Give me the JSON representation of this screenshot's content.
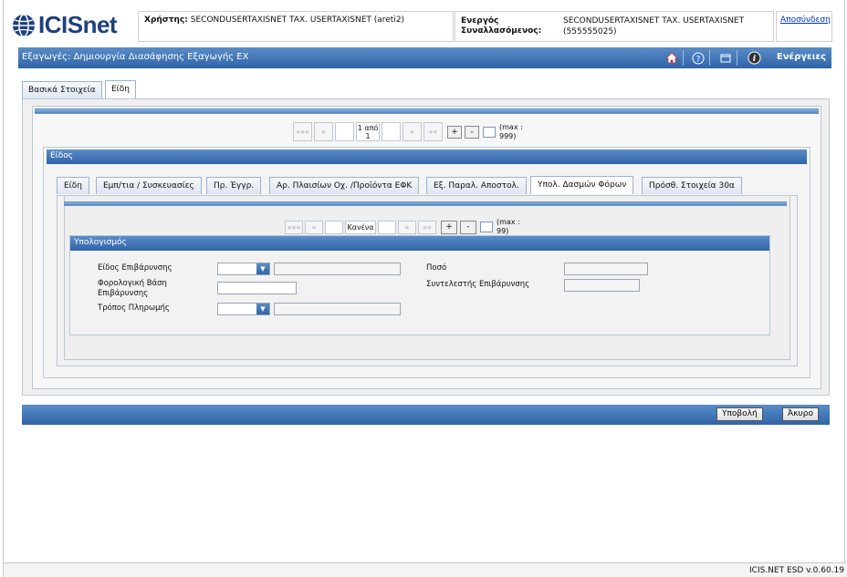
{
  "header": {
    "logo_text": "ICISnet",
    "user_label": "Χρήστης:",
    "user_value": "SECONDUSERTAXISNET TAX. USERTAXISNET (areti2)",
    "active_label": "Ενεργός Συναλλασόμενος:",
    "active_value": "SECONDUSERTAXISNET TAX. USERTAXISNET (555555025)",
    "logout": "Αποσύνδεση"
  },
  "titlebar": {
    "title": "Εξαγωγές: Δημιουργία Διασάφησης Εξαγωγής ΕΧ",
    "actions": "Ενέργειες"
  },
  "main_tabs": [
    "Βασικά Στοιχεία",
    "Είδη"
  ],
  "outer_pager": {
    "first": "«««",
    "prev": "«",
    "page_text": "1 από 1",
    "next": "»",
    "last": "»»",
    "plus": "+",
    "minus": "-",
    "max": "(max : 999)"
  },
  "eidos_section": {
    "title": "Είδος"
  },
  "sub_tabs": [
    "Είδη",
    "Εμπ/τια / Συσκευασίες",
    "Πρ. Έγγρ.",
    "Αρ. Πλαισίων Οχ. /Προϊόντα ΕΦΚ",
    "Εξ. Παραλ. Αποστολ.",
    "Υπολ. Δασμών Φόρων",
    "Πρόσθ. Στοιχεία 30α"
  ],
  "inner_pager": {
    "first": "«««",
    "prev": "«",
    "page_text": "Κανένα",
    "next": "»",
    "last": "»»",
    "plus": "+",
    "minus": "-",
    "max": "(max : 99)"
  },
  "calc_section": {
    "title": "Υπολογισμός",
    "labels": {
      "charge_type": "Είδος Επιβάρυνσης",
      "tax_base": "Φορολογική Βάση Επιβάρυνσης",
      "payment_method": "Τρόπος Πληρωμής",
      "amount": "Ποσό",
      "charge_rate": "Συντελεστής Επιβάρυνσης"
    }
  },
  "footer": {
    "submit": "Υποβολή",
    "cancel": "Άκυρο"
  },
  "version": "ICIS.NET ESD v.0.60.19"
}
